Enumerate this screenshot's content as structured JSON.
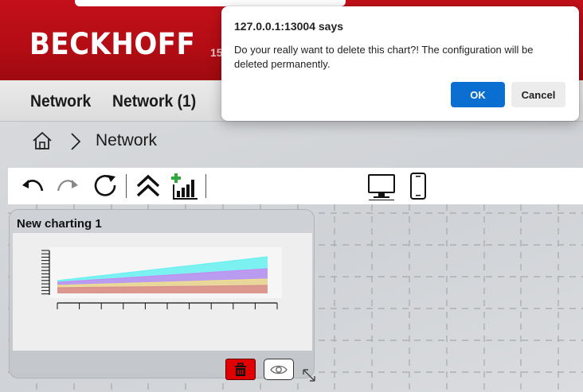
{
  "header": {
    "logo_text": "BECKHOFF",
    "partial_text": "15",
    "brand_color": "#c4101a"
  },
  "nav": {
    "tabs": [
      {
        "label": "Network"
      },
      {
        "label": "Network (1)"
      }
    ]
  },
  "breadcrumb": {
    "home_icon": "home-icon",
    "separator_icon": "chevron-right-icon",
    "current": "Network"
  },
  "toolbar": {
    "buttons": [
      {
        "name": "undo",
        "icon": "undo-icon"
      },
      {
        "name": "redo",
        "icon": "redo-icon"
      },
      {
        "name": "refresh",
        "icon": "refresh-icon"
      },
      {
        "name": "collapse",
        "icon": "double-chevron-up-icon"
      },
      {
        "name": "add-chart",
        "icon": "add-chart-icon"
      },
      {
        "name": "desktop-view",
        "icon": "desktop-icon"
      },
      {
        "name": "mobile-view",
        "icon": "mobile-icon"
      }
    ]
  },
  "card": {
    "title": "New charting 1",
    "delete_icon": "trash-icon",
    "view_icon": "eye-icon",
    "resize_icon": "resize-icon"
  },
  "chart_data": {
    "type": "area",
    "title": "",
    "xlabel": "",
    "ylabel": "",
    "series": [
      {
        "color": "#66f0f0"
      },
      {
        "color": "#c48cf0"
      },
      {
        "color": "#f0e08c"
      },
      {
        "color": "#d98c8c"
      }
    ]
  },
  "dialog": {
    "title": "127.0.0.1:13004 says",
    "message": "Do your really want to delete this chart?! The configuration will be deleted permanently.",
    "ok_label": "OK",
    "cancel_label": "Cancel",
    "ok_color": "#0a6fd1"
  }
}
